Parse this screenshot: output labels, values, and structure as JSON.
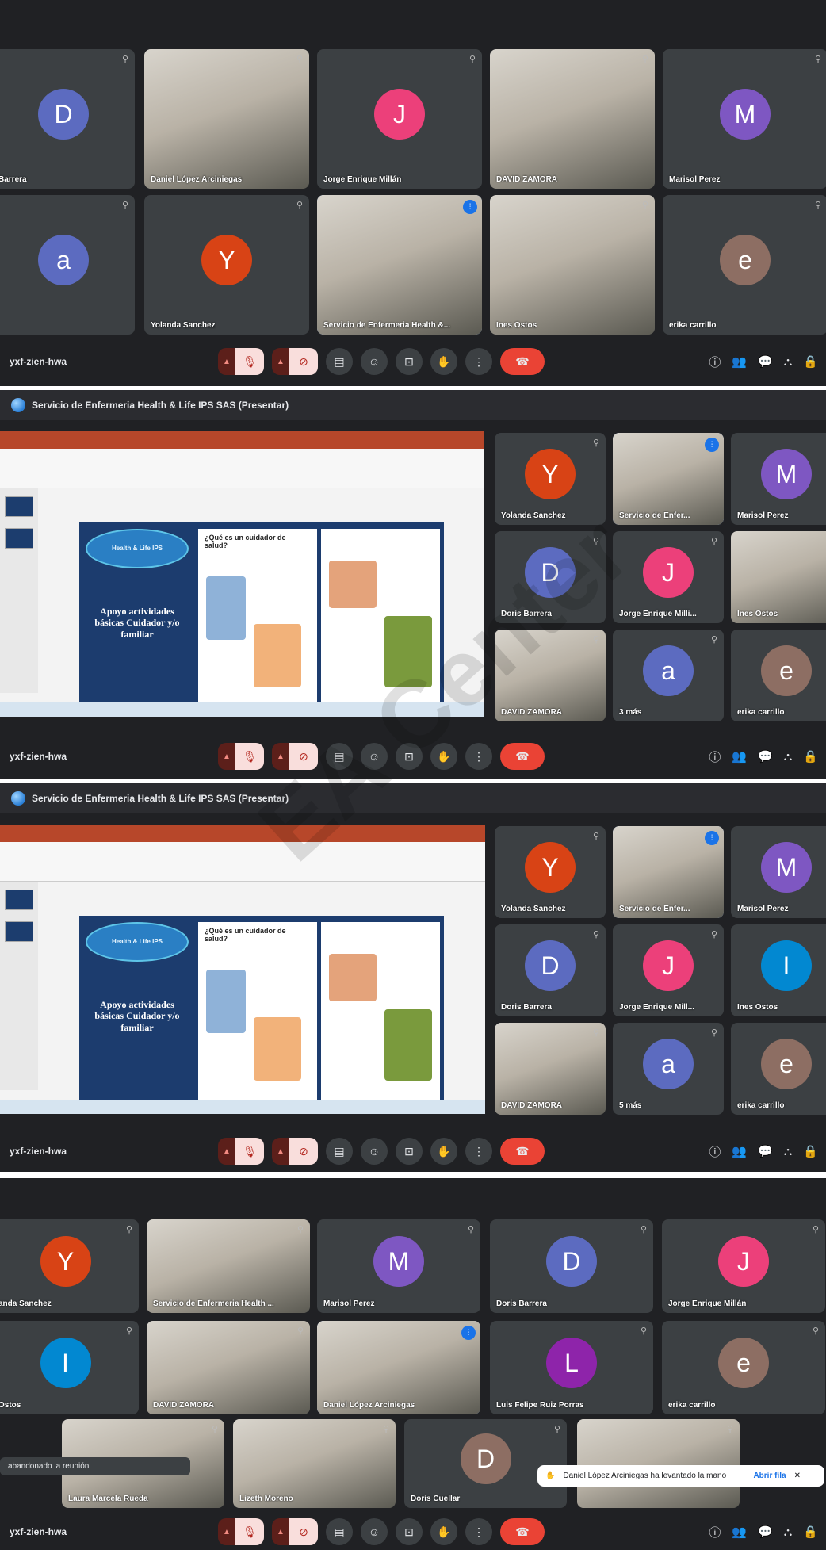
{
  "meeting_code": "yxf-zien-hwa",
  "presenter_window_title": "Servicio de Enfermeria Health & Life IPS SAS (Presentar)",
  "shot1": {
    "tiles": [
      {
        "initial": "D",
        "name": "Barrera",
        "color": "#5c6bc0"
      },
      {
        "initial": "",
        "name": "Daniel López Arciniegas",
        "color": "#3c4043"
      },
      {
        "initial": "J",
        "name": "Jorge Enrique Millán",
        "color": "#ec407a"
      },
      {
        "initial": "",
        "name": "DAVID ZAMORA",
        "color": "#3c4043"
      },
      {
        "initial": "M",
        "name": "Marisol Perez",
        "color": "#7e57c2"
      },
      {
        "initial": "a",
        "name": "",
        "color": "#5c6bc0"
      },
      {
        "initial": "Y",
        "name": "Yolanda Sanchez",
        "color": "#d84315"
      },
      {
        "initial": "",
        "name": "Servicio de Enfermeria Health &...",
        "color": "#3c4043"
      },
      {
        "initial": "",
        "name": "Ines Ostos",
        "color": "#3c4043"
      },
      {
        "initial": "e",
        "name": "erika carrillo",
        "color": "#8d6e63"
      }
    ],
    "participant_count": "10"
  },
  "shot2": {
    "tiles": [
      {
        "initial": "Y",
        "name": "Yolanda Sanchez",
        "color": "#d84315"
      },
      {
        "initial": "",
        "name": "Servicio de Enfer...",
        "color": "#3c4043"
      },
      {
        "initial": "M",
        "name": "Marisol Perez",
        "color": "#7e57c2"
      },
      {
        "initial": "D",
        "name": "Doris Barrera",
        "color": "#5c6bc0"
      },
      {
        "initial": "J",
        "name": "Jorge Enrique Milli...",
        "color": "#ec407a"
      },
      {
        "initial": "",
        "name": "Ines Ostos",
        "color": "#3c4043"
      },
      {
        "initial": "",
        "name": "DAVID ZAMORA",
        "color": "#3c4043"
      },
      {
        "initial": "a",
        "name": "3 más",
        "color": "#5c6bc0"
      },
      {
        "initial": "e",
        "name": "erika carrillo",
        "color": "#8d6e63"
      }
    ],
    "participant_count": "12"
  },
  "shot3": {
    "tiles": [
      {
        "initial": "Y",
        "name": "Yolanda Sanchez",
        "color": "#d84315"
      },
      {
        "initial": "",
        "name": "Servicio de Enfer...",
        "color": "#3c4043"
      },
      {
        "initial": "M",
        "name": "Marisol Perez",
        "color": "#7e57c2"
      },
      {
        "initial": "D",
        "name": "Doris Barrera",
        "color": "#5c6bc0"
      },
      {
        "initial": "J",
        "name": "Jorge Enrique Mill...",
        "color": "#ec407a"
      },
      {
        "initial": "I",
        "name": "Ines Ostos",
        "color": "#0288d1"
      },
      {
        "initial": "",
        "name": "DAVID ZAMORA",
        "color": "#3c4043"
      },
      {
        "initial": "a",
        "name": "5 más",
        "color": "#5c6bc0"
      },
      {
        "initial": "e",
        "name": "erika carrillo",
        "color": "#8d6e63"
      }
    ],
    "participant_count": "14"
  },
  "shot4": {
    "tiles": [
      {
        "initial": "Y",
        "name": "anda Sanchez",
        "color": "#d84315"
      },
      {
        "initial": "",
        "name": "Servicio de Enfermeria Health ...",
        "color": "#3c4043"
      },
      {
        "initial": "M",
        "name": "Marisol Perez",
        "color": "#7e57c2"
      },
      {
        "initial": "D",
        "name": "Doris Barrera",
        "color": "#5c6bc0"
      },
      {
        "initial": "J",
        "name": "Jorge Enrique Millán",
        "color": "#ec407a"
      },
      {
        "initial": "I",
        "name": "Ostos",
        "color": "#0288d1"
      },
      {
        "initial": "",
        "name": "DAVID ZAMORA",
        "color": "#3c4043"
      },
      {
        "initial": "",
        "name": "Daniel López Arciniegas",
        "color": "#3c4043"
      },
      {
        "initial": "L",
        "name": "Luis Felipe Ruiz Porras",
        "color": "#8e24aa"
      },
      {
        "initial": "e",
        "name": "erika carrillo",
        "color": "#8d6e63"
      },
      {
        "initial": "",
        "name": "Laura Marcela Rueda",
        "color": "#3c4043"
      },
      {
        "initial": "",
        "name": "Lizeth Moreno",
        "color": "#3c4043"
      },
      {
        "initial": "D",
        "name": "Doris Cuellar",
        "color": "#8d6e63"
      },
      {
        "initial": "",
        "name": "",
        "color": "#3c4043"
      }
    ],
    "participant_count": "14",
    "left_toast": "abandonado la reunión",
    "raise_hand": {
      "text": "Daniel López Arciniegas ha levantado la mano",
      "action": "Abrir fila"
    }
  },
  "slide": {
    "logo_text": "Health & Life IPS",
    "brand": "Health & Life IPS",
    "title": "Apoyo actividades básicas Cuidador y/o familiar",
    "question": "¿Qué es un cuidador de salud?"
  },
  "watermark": "EA Center"
}
